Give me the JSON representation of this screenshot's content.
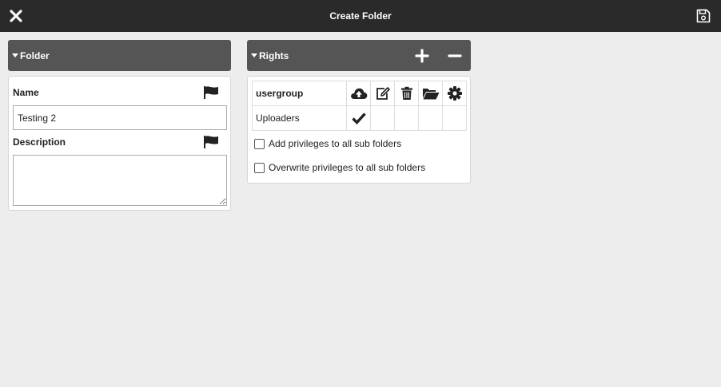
{
  "header": {
    "title": "Create Folder",
    "close_icon": "close-icon",
    "save_icon": "save-icon"
  },
  "folder_panel": {
    "title": "Folder",
    "name_label": "Name",
    "name_value": "Testing 2",
    "description_label": "Description",
    "description_value": "",
    "flag_icon": "flag-icon"
  },
  "rights_panel": {
    "title": "Rights",
    "add_icon": "plus-icon",
    "remove_icon": "minus-icon",
    "table": {
      "header_label": "usergroup",
      "column_icons": [
        "upload-icon",
        "edit-icon",
        "trash-icon",
        "folder-open-icon",
        "gear-icon"
      ],
      "rows": [
        {
          "name": "Uploaders",
          "checks": [
            true,
            false,
            false,
            false,
            false
          ]
        }
      ]
    },
    "options": [
      {
        "label": "Add privileges to all sub folders",
        "checked": false
      },
      {
        "label": "Overwrite privileges to all sub folders",
        "checked": false
      }
    ]
  },
  "colors": {
    "topbar": "#2a2a2a",
    "panel_header": "#555555",
    "background": "#ededed"
  }
}
